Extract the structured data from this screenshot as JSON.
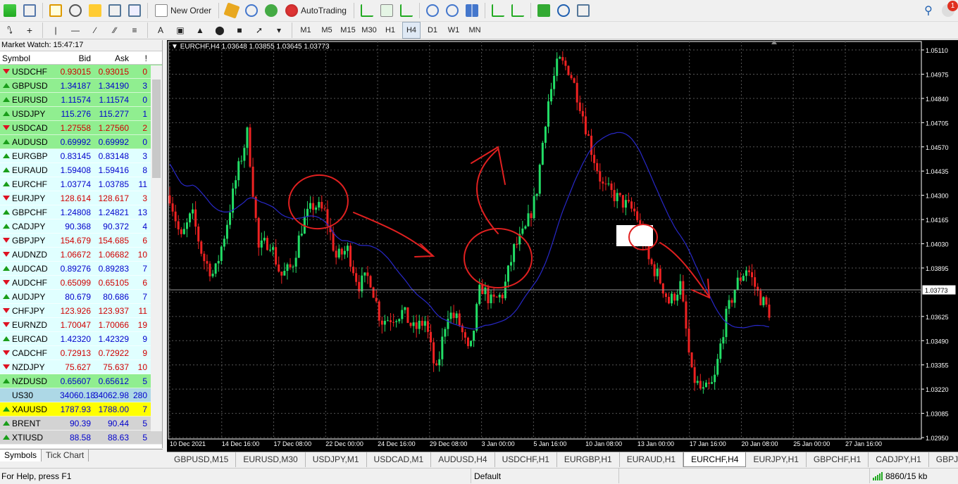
{
  "toolbar": {
    "new_order": "New Order",
    "auto_trading": "AutoTrading",
    "timeframes": [
      "M1",
      "M5",
      "M15",
      "M30",
      "H1",
      "H4",
      "D1",
      "W1",
      "MN"
    ],
    "active_timeframe": "H4",
    "notification_count": "1"
  },
  "market_watch": {
    "title": "Market Watch: 15:47:17",
    "headers": {
      "symbol": "Symbol",
      "bid": "Bid",
      "ask": "Ask",
      "spread": "!"
    },
    "rows": [
      {
        "symbol": "USDCHF",
        "bid": "0.93015",
        "ask": "0.93015",
        "spread": "0",
        "dir": "down",
        "bg": "#90ee90",
        "color": "#d00000"
      },
      {
        "symbol": "GBPUSD",
        "bid": "1.34187",
        "ask": "1.34190",
        "spread": "3",
        "dir": "up",
        "bg": "#90ee90",
        "color": "#0000cc"
      },
      {
        "symbol": "EURUSD",
        "bid": "1.11574",
        "ask": "1.11574",
        "spread": "0",
        "dir": "up",
        "bg": "#90ee90",
        "color": "#0000cc"
      },
      {
        "symbol": "USDJPY",
        "bid": "115.276",
        "ask": "115.277",
        "spread": "1",
        "dir": "up",
        "bg": "#90ee90",
        "color": "#0000cc"
      },
      {
        "symbol": "USDCAD",
        "bid": "1.27558",
        "ask": "1.27560",
        "spread": "2",
        "dir": "down",
        "bg": "#90ee90",
        "color": "#d00000"
      },
      {
        "symbol": "AUDUSD",
        "bid": "0.69992",
        "ask": "0.69992",
        "spread": "0",
        "dir": "up",
        "bg": "#90ee90",
        "color": "#0000cc"
      },
      {
        "symbol": "EURGBP",
        "bid": "0.83145",
        "ask": "0.83148",
        "spread": "3",
        "dir": "up",
        "bg": "#e0ffff",
        "color": "#0000cc"
      },
      {
        "symbol": "EURAUD",
        "bid": "1.59408",
        "ask": "1.59416",
        "spread": "8",
        "dir": "up",
        "bg": "#e0ffff",
        "color": "#0000cc"
      },
      {
        "symbol": "EURCHF",
        "bid": "1.03774",
        "ask": "1.03785",
        "spread": "11",
        "dir": "up",
        "bg": "#e0ffff",
        "color": "#0000cc"
      },
      {
        "symbol": "EURJPY",
        "bid": "128.614",
        "ask": "128.617",
        "spread": "3",
        "dir": "down",
        "bg": "#e0ffff",
        "color": "#d00000"
      },
      {
        "symbol": "GBPCHF",
        "bid": "1.24808",
        "ask": "1.24821",
        "spread": "13",
        "dir": "up",
        "bg": "#e0ffff",
        "color": "#0000cc"
      },
      {
        "symbol": "CADJPY",
        "bid": "90.368",
        "ask": "90.372",
        "spread": "4",
        "dir": "up",
        "bg": "#e0ffff",
        "color": "#0000cc"
      },
      {
        "symbol": "GBPJPY",
        "bid": "154.679",
        "ask": "154.685",
        "spread": "6",
        "dir": "down",
        "bg": "#e0ffff",
        "color": "#d00000"
      },
      {
        "symbol": "AUDNZD",
        "bid": "1.06672",
        "ask": "1.06682",
        "spread": "10",
        "dir": "down",
        "bg": "#e0ffff",
        "color": "#d00000"
      },
      {
        "symbol": "AUDCAD",
        "bid": "0.89276",
        "ask": "0.89283",
        "spread": "7",
        "dir": "up",
        "bg": "#e0ffff",
        "color": "#0000cc"
      },
      {
        "symbol": "AUDCHF",
        "bid": "0.65099",
        "ask": "0.65105",
        "spread": "6",
        "dir": "down",
        "bg": "#e0ffff",
        "color": "#d00000"
      },
      {
        "symbol": "AUDJPY",
        "bid": "80.679",
        "ask": "80.686",
        "spread": "7",
        "dir": "up",
        "bg": "#e0ffff",
        "color": "#0000cc"
      },
      {
        "symbol": "CHFJPY",
        "bid": "123.926",
        "ask": "123.937",
        "spread": "11",
        "dir": "down",
        "bg": "#e0ffff",
        "color": "#d00000"
      },
      {
        "symbol": "EURNZD",
        "bid": "1.70047",
        "ask": "1.70066",
        "spread": "19",
        "dir": "down",
        "bg": "#e0ffff",
        "color": "#d00000"
      },
      {
        "symbol": "EURCAD",
        "bid": "1.42320",
        "ask": "1.42329",
        "spread": "9",
        "dir": "up",
        "bg": "#e0ffff",
        "color": "#0000cc"
      },
      {
        "symbol": "CADCHF",
        "bid": "0.72913",
        "ask": "0.72922",
        "spread": "9",
        "dir": "down",
        "bg": "#e0ffff",
        "color": "#d00000"
      },
      {
        "symbol": "NZDJPY",
        "bid": "75.627",
        "ask": "75.637",
        "spread": "10",
        "dir": "down",
        "bg": "#e0ffff",
        "color": "#d00000"
      },
      {
        "symbol": "NZDUSD",
        "bid": "0.65607",
        "ask": "0.65612",
        "spread": "5",
        "dir": "up",
        "bg": "#90ee90",
        "color": "#0000cc"
      },
      {
        "symbol": "US30",
        "bid": "34060.18",
        "ask": "34062.98",
        "spread": "280",
        "dir": "none",
        "bg": "#add8e6",
        "color": "#0000cc"
      },
      {
        "symbol": "XAUUSD",
        "bid": "1787.93",
        "ask": "1788.00",
        "spread": "7",
        "dir": "up",
        "bg": "#ffff00",
        "color": "#0000cc"
      },
      {
        "symbol": "BRENT",
        "bid": "90.39",
        "ask": "90.44",
        "spread": "5",
        "dir": "up",
        "bg": "#d3d3d3",
        "color": "#0000cc"
      },
      {
        "symbol": "XTIUSD",
        "bid": "88.58",
        "ask": "88.63",
        "spread": "5",
        "dir": "up",
        "bg": "#d3d3d3",
        "color": "#0000cc"
      }
    ],
    "tabs": [
      "Symbols",
      "Tick Chart"
    ]
  },
  "chart": {
    "header": "EURCHF,H4  1.03648 1.03855 1.03645 1.03773",
    "current_price_label": "1.03773"
  },
  "chart_data": {
    "type": "candlestick",
    "symbol": "EURCHF",
    "timeframe": "H4",
    "y_ticks": [
      "1.05110",
      "1.04975",
      "1.04840",
      "1.04705",
      "1.04570",
      "1.04435",
      "1.04300",
      "1.04165",
      "1.04030",
      "1.03895",
      "1.03760",
      "1.03625",
      "1.03490",
      "1.03355",
      "1.03220",
      "1.03085",
      "1.02950"
    ],
    "ylim": [
      1.0295,
      1.0511
    ],
    "x_ticks": [
      "10 Dec 2021",
      "14 Dec 16:00",
      "17 Dec 08:00",
      "22 Dec 00:00",
      "24 Dec 16:00",
      "29 Dec 08:00",
      "3 Jan 00:00",
      "5 Jan 16:00",
      "10 Jan 08:00",
      "13 Jan 00:00",
      "17 Jan 16:00",
      "20 Jan 08:00",
      "25 Jan 00:00",
      "27 Jan 16:00"
    ],
    "current_price": 1.03773,
    "close_path": [
      1.043,
      1.0405,
      1.042,
      1.0395,
      1.0385,
      1.041,
      1.044,
      1.0465,
      1.04,
      1.0405,
      1.0385,
      1.039,
      1.0415,
      1.0425,
      1.042,
      1.0395,
      1.04,
      1.038,
      1.0385,
      1.036,
      1.0362,
      1.0365,
      1.0355,
      1.036,
      1.033,
      1.0365,
      1.036,
      1.034,
      1.038,
      1.037,
      1.0375,
      1.04,
      1.041,
      1.043,
      1.048,
      1.0505,
      1.05,
      1.048,
      1.0455,
      1.0435,
      1.043,
      1.0425,
      1.042,
      1.0395,
      1.0385,
      1.037,
      1.038,
      1.033,
      1.032,
      1.0325,
      1.036,
      1.038,
      1.039,
      1.0375,
      1.0365
    ]
  },
  "chart_tabs": [
    "GBPUSD,M15",
    "EURUSD,M30",
    "USDJPY,M1",
    "USDCAD,M1",
    "AUDUSD,H4",
    "USDCHF,H1",
    "EURGBP,H1",
    "EURAUD,H1",
    "EURCHF,H4",
    "EURJPY,H1",
    "GBPCHF,H1",
    "CADJPY,H1",
    "GBPJPY,"
  ],
  "active_chart_tab": "EURCHF,H4",
  "status": {
    "help": "For Help, press F1",
    "profile": "Default",
    "traffic": "8860/15 kb"
  }
}
